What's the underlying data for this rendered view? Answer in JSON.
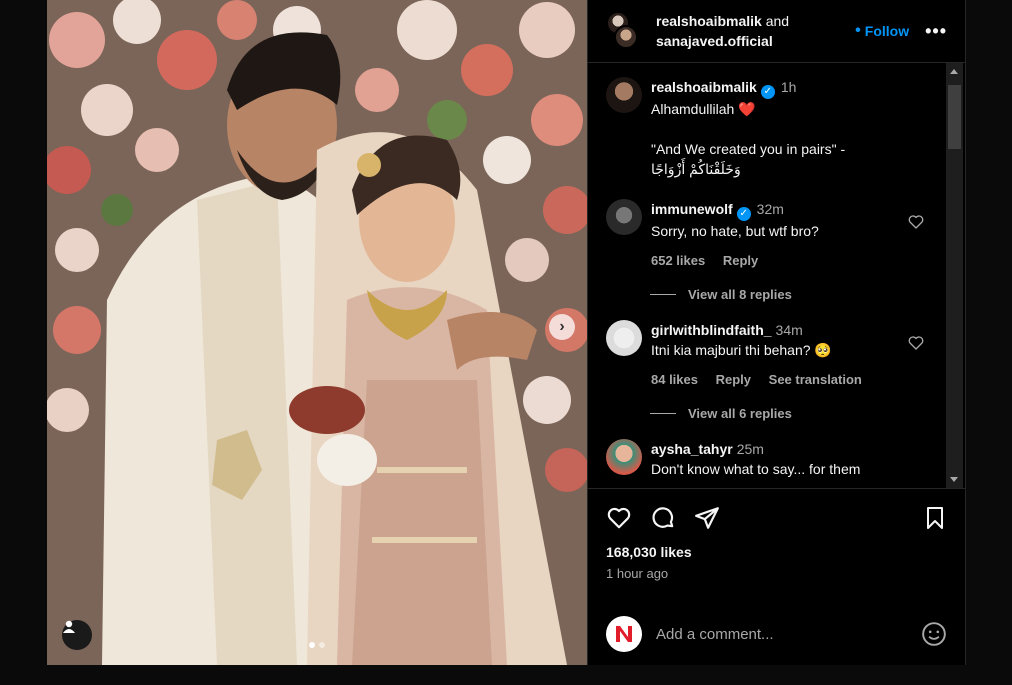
{
  "post": {
    "authors": {
      "primary": "realshoaibmalik",
      "joiner": "and",
      "secondary": "sanajaved.official"
    },
    "follow_label": "Follow",
    "more_label": "•••",
    "caption": {
      "username": "realshoaibmalik",
      "time": "1h",
      "line1": "Alhamdullilah ❤️",
      "line2": "\"And We created you in pairs\" -",
      "line3": "وَخَلَقْنَاكُمْ أَزْوَاجًا"
    },
    "comments": [
      {
        "username": "immunewolf",
        "verified": true,
        "time": "32m",
        "text": "Sorry, no hate, but wtf bro?",
        "likes": "652 likes",
        "reply": "Reply",
        "view_replies": "View all 8 replies"
      },
      {
        "username": "girlwithblindfaith_",
        "verified": false,
        "time": "34m",
        "text": "Itni kia majburi thi behan? 🥺",
        "likes": "84 likes",
        "reply": "Reply",
        "translation": "See translation",
        "view_replies": "View all 6 replies"
      },
      {
        "username": "aysha_tahyr",
        "verified": false,
        "time": "25m",
        "text": "Don't know what to say... for them"
      }
    ],
    "likes_count": "168,030 likes",
    "posted_ago": "1 hour ago",
    "add_comment_placeholder": "Add a comment...",
    "carousel": {
      "total": 2,
      "current": 1
    }
  },
  "icons": {
    "like": "heart-icon",
    "comment": "comment-icon",
    "share": "share-icon",
    "save": "bookmark-icon",
    "emoji": "emoji-icon",
    "tag": "user-tag-icon",
    "next": "chevron-right-icon"
  },
  "colors": {
    "accent": "#0095f6",
    "background": "#000000",
    "muted": "#a8a8a8"
  }
}
